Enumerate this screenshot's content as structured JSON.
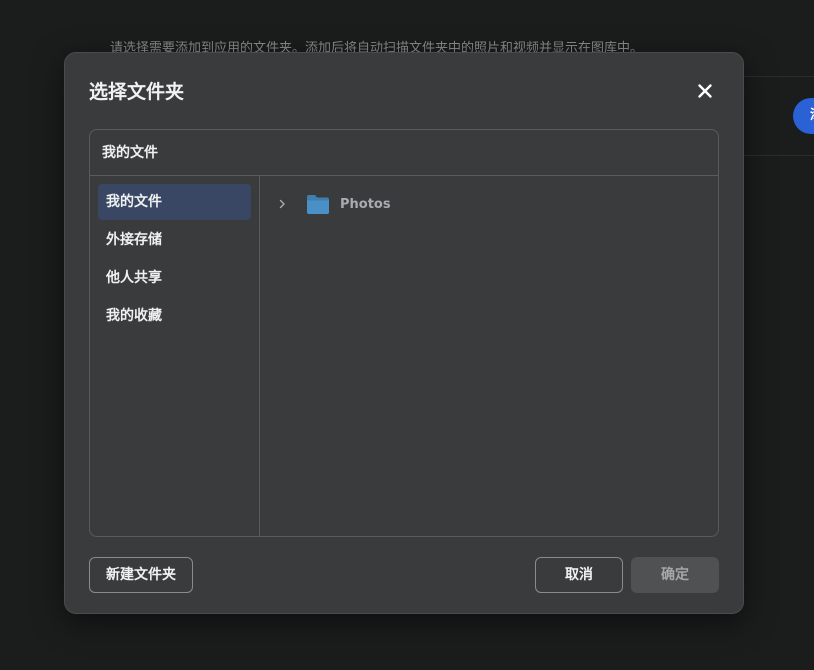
{
  "background": {
    "description": "请选择需要添加到应用的文件夹。添加后将自动扫描文件夹中的照片和视频并显示在图库中。",
    "add_button_label": "添"
  },
  "dialog": {
    "title": "选择文件夹",
    "path": "我的文件",
    "sidebar": [
      {
        "label": "我的文件",
        "active": true
      },
      {
        "label": "外接存储",
        "active": false
      },
      {
        "label": "他人共享",
        "active": false
      },
      {
        "label": "我的收藏",
        "active": false
      }
    ],
    "folders": [
      {
        "name": "Photos",
        "icon": "folder-icon"
      }
    ],
    "buttons": {
      "new_folder": "新建文件夹",
      "cancel": "取消",
      "confirm": "确定"
    }
  },
  "colors": {
    "accent": "#2a62d6",
    "selected_item": "#394764",
    "dialog_bg": "#3a3b3d",
    "page_bg": "#1b1c1c"
  }
}
